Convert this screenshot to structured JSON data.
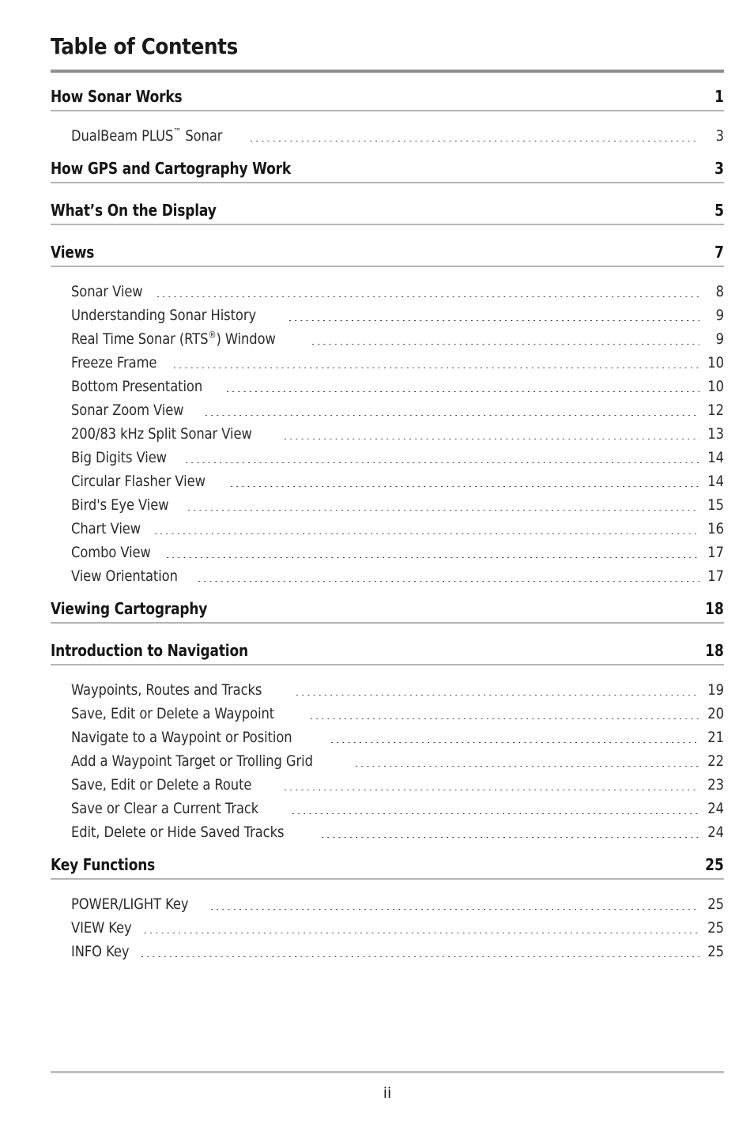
{
  "document": {
    "title": "Table of Contents",
    "footer_page_number": "ii"
  },
  "toc": {
    "entries": [
      {
        "level": 1,
        "title": "How Sonar Works",
        "page": "1"
      },
      {
        "level": 2,
        "title": "DualBeam PLUS™ Sonar",
        "page": "3"
      },
      {
        "level": 1,
        "title": "How GPS and Cartography Work",
        "page": "3"
      },
      {
        "level": 1,
        "title": "What’s On the Display",
        "page": "5"
      },
      {
        "level": 1,
        "title": "Views",
        "page": "7"
      },
      {
        "level": 2,
        "title": "Sonar View",
        "page": "8"
      },
      {
        "level": 2,
        "title": "Understanding Sonar History",
        "page": "9"
      },
      {
        "level": 2,
        "title": "Real Time Sonar (RTS®) Window",
        "page": "9"
      },
      {
        "level": 2,
        "title": "Freeze Frame",
        "page": "10"
      },
      {
        "level": 2,
        "title": "Bottom Presentation",
        "page": "10"
      },
      {
        "level": 2,
        "title": "Sonar Zoom View",
        "page": "12"
      },
      {
        "level": 2,
        "title": "200/83 kHz Split Sonar View",
        "page": "13"
      },
      {
        "level": 2,
        "title": "Big Digits View",
        "page": "14"
      },
      {
        "level": 2,
        "title": "Circular Flasher View",
        "page": "14"
      },
      {
        "level": 2,
        "title": "Bird's Eye View",
        "page": "15"
      },
      {
        "level": 2,
        "title": "Chart View",
        "page": "16"
      },
      {
        "level": 2,
        "title": "Combo View",
        "page": "17"
      },
      {
        "level": 2,
        "title": "View Orientation",
        "page": "17"
      },
      {
        "level": 1,
        "title": "Viewing Cartography",
        "page": "18"
      },
      {
        "level": 1,
        "title": "Introduction to Navigation",
        "page": "18"
      },
      {
        "level": 2,
        "title": "Waypoints, Routes and Tracks",
        "page": "19"
      },
      {
        "level": 2,
        "title": "Save, Edit or Delete a Waypoint",
        "page": "20"
      },
      {
        "level": 2,
        "title": "Navigate to a Waypoint or Position",
        "page": "21"
      },
      {
        "level": 2,
        "title": "Add a Waypoint Target or Trolling Grid",
        "page": "22"
      },
      {
        "level": 2,
        "title": "Save, Edit or Delete a Route",
        "page": "23"
      },
      {
        "level": 2,
        "title": "Save or Clear a Current Track",
        "page": "24"
      },
      {
        "level": 2,
        "title": "Edit, Delete or Hide Saved Tracks",
        "page": "24"
      },
      {
        "level": 1,
        "title": "Key Functions",
        "page": "25"
      },
      {
        "level": 2,
        "title": "POWER/LIGHT Key",
        "page": "25"
      },
      {
        "level": 2,
        "title": "VIEW Key",
        "page": "25"
      },
      {
        "level": 2,
        "title": "INFO Key",
        "page": "25"
      }
    ]
  },
  "colors": {
    "title_rule": "#8e8e8e",
    "heading_rule": "#b4b4b4",
    "footer_rule": "#bfbfbf",
    "text": "#1a1a1a"
  }
}
